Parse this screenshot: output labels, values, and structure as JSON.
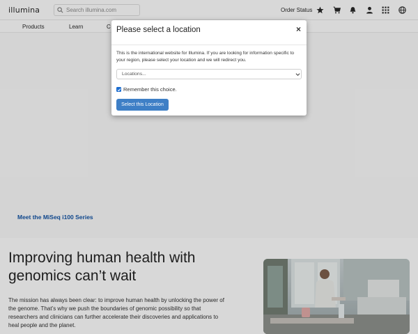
{
  "header": {
    "logo": "illumina",
    "search_placeholder": "Search illumina.com",
    "order_status": "Order Status",
    "icons": [
      "star-icon",
      "cart-icon",
      "bell-icon",
      "user-icon",
      "apps-grid-icon",
      "globe-icon"
    ]
  },
  "nav": {
    "items": [
      "Products",
      "Learn",
      "C"
    ]
  },
  "hero": {
    "link": "Meet the MiSeq i100 Series"
  },
  "main": {
    "headline": "Improving human health with genomics can’t wait",
    "body": "The mission has always been clear: to improve human health by unlocking the power of the genome. That’s why we push the boundaries of genomic possibility so that researchers and clinicians can further accelerate their discoveries and applications to heal people and the planet."
  },
  "modal": {
    "title": "Please select a location",
    "close": "×",
    "description": "This is the international website for Illumina. If you are looking for information specific to your region, please select your location and we will redirect you.",
    "select_value": "Locations...",
    "remember_label": "Remember this choice.",
    "remember_checked": true,
    "button_label": "Select this Location"
  },
  "colors": {
    "accent": "#3e7fc6",
    "checkbox": "#1c6dd0",
    "link": "#0b4fa3"
  }
}
